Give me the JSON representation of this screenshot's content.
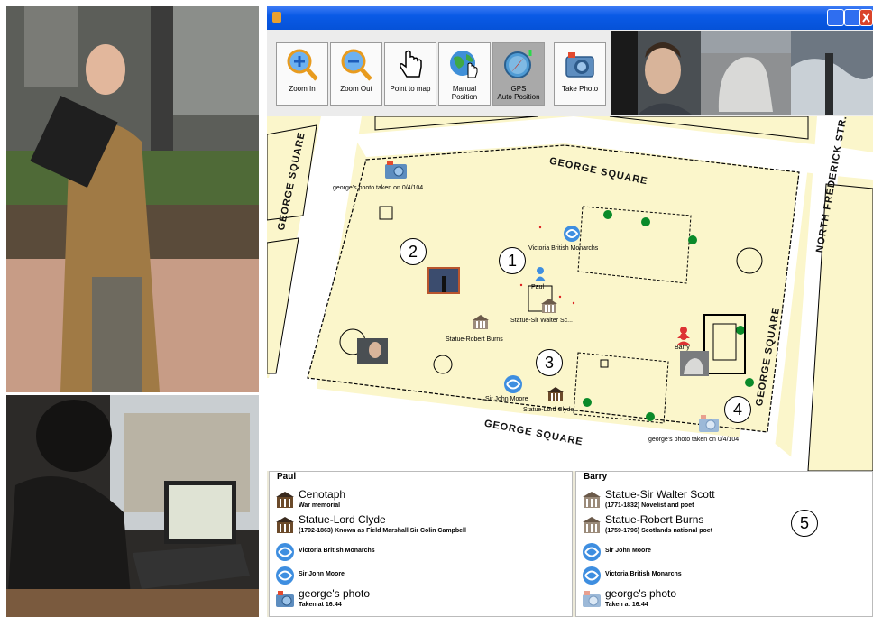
{
  "toolbar": {
    "buttons": [
      {
        "label": "Zoom In",
        "icon": "zoom-in-icon"
      },
      {
        "label": "Zoom Out",
        "icon": "zoom-out-icon"
      },
      {
        "label": "Point to map",
        "icon": "hand-pointer-icon"
      },
      {
        "label": "Manual Position",
        "icon": "globe-hand-icon"
      },
      {
        "label": "GPS Auto Position",
        "icon": "compass-icon",
        "active": true
      },
      {
        "label": "Take Photo",
        "icon": "camera-icon"
      }
    ]
  },
  "map": {
    "roads": [
      "GEORGE SQUARE",
      "GEORGE SQUARE",
      "GEORGE SQUARE",
      "GEORGE SQUARE",
      "NORTH FREDERICK STR."
    ],
    "markers": {
      "photo_top": "george's photo taken on 0/4/104",
      "monarchs": "Victoria British Monarchs",
      "paul": "Paul",
      "walter_scott": "Statue-Sir Walter Sc...",
      "robert_burns": "Statue-Robert Burns",
      "john_moore": "Sir John Moore",
      "lord_clyde": "Statue-Lord Clyde",
      "barry": "Barry",
      "photo_bottom": "george's photo taken on 0/4/104"
    },
    "callouts": [
      "1",
      "2",
      "3",
      "4",
      "5"
    ]
  },
  "panes": {
    "paul": {
      "title": "Paul",
      "items": [
        {
          "title": "Cenotaph",
          "subtitle": "War memorial",
          "icon": "monument-icon"
        },
        {
          "title": "Statue-Lord Clyde",
          "subtitle": "(1792-1863) Known as Field Marshall Sir Colin Campbell",
          "icon": "monument-icon"
        },
        {
          "title": "Victoria British Monarchs",
          "icon": "internet-explorer-icon"
        },
        {
          "title": "Sir John Moore",
          "icon": "internet-explorer-icon"
        },
        {
          "title": "george's photo",
          "subtitle": "Taken at 16:44",
          "icon": "camera-icon"
        }
      ]
    },
    "barry": {
      "title": "Barry",
      "items": [
        {
          "title": "Statue-Sir Walter Scott",
          "subtitle": "(1771-1832) Novelist and poet",
          "icon": "monument-icon"
        },
        {
          "title": "Statue-Robert Burns",
          "subtitle": "(1759-1796) Scotlands national poet",
          "icon": "monument-icon"
        },
        {
          "title": "Sir John Moore",
          "icon": "internet-explorer-icon"
        },
        {
          "title": "Victoria British Monarchs",
          "icon": "internet-explorer-icon"
        },
        {
          "title": "george's photo",
          "subtitle": "Taken at 16:44",
          "icon": "camera-icon"
        }
      ]
    }
  }
}
